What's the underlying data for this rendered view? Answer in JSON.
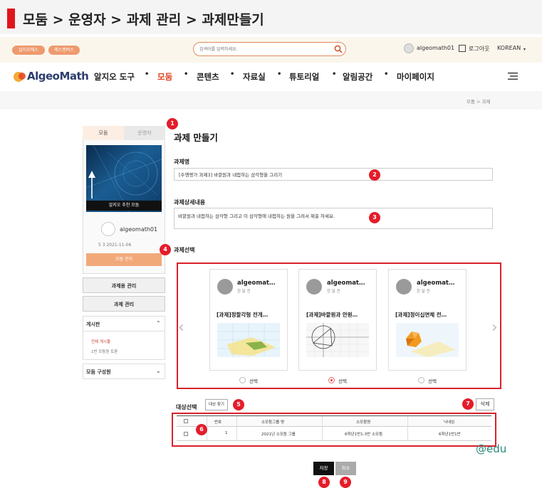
{
  "doc_header": {
    "title": "모둠 > 운영자 > 과제 관리 > 과제만들기"
  },
  "util": {
    "pill_1": "알지오매스",
    "pill_2": "매스캔버스",
    "search_placeholder": "검색어를 입력하세요.",
    "user_name": "algeomath01",
    "logout": "로그아웃",
    "language": "KOREAN",
    "caret": "▾"
  },
  "nav": {
    "logo": "AlgeoMath",
    "items": [
      "알지오 도구",
      "모둠",
      "콘텐츠",
      "자료실",
      "튜토리얼",
      "알림공간",
      "마이페이지"
    ],
    "dot": "•",
    "active_color": "#e2431f"
  },
  "breadcrumb": "모둠 > 과제",
  "sidebar": {
    "tab_group": "모둠",
    "tab_operator": "운영자",
    "banner_caption": "알지오 추천 모둠",
    "username": "algeomath01",
    "stats": "5   3   2021-11-06",
    "action": "모둠 관리",
    "btn_manage_tasks": "과제용 관리",
    "btn_manage_assign": "과제 관리",
    "board_title": "게시판",
    "board_items": [
      "전체 게시물",
      "1번 모둠원 토론"
    ],
    "member_title": "모둠 구성원",
    "caret_up": "⌃",
    "caret_down": "⌄"
  },
  "form": {
    "heading": "과제 만들기",
    "name_label": "과제명",
    "name_value": "[수행평가 과제3] 바깥원과 내접하는 삼각형을 그리기",
    "desc_label": "과제상세내용",
    "desc_value": "바깥원과 내접하는 삼각형 그리고 이 삼각형에 내접하는 원을 그려서 제출 하세요.",
    "select_label": "과제선택",
    "cards": [
      {
        "user": "algeomat…",
        "sub": "한 달 전",
        "title": "[과제]정팔각형 전개…",
        "radio": "선택",
        "selected": false
      },
      {
        "user": "algeomat…",
        "sub": "한 달 전",
        "title": "[과제]바깥원과 안원…",
        "radio": "선택",
        "selected": true
      },
      {
        "user": "algeomat…",
        "sub": "한 달 전",
        "title": "[과제]정이십면체 전…",
        "radio": "선택",
        "selected": false
      }
    ],
    "arrow_left": "‹",
    "arrow_right": "›",
    "target_label": "대상선택",
    "find_target": "대상 찾기",
    "delete": "삭제",
    "table": {
      "headers": [
        "번호",
        "소모둠그룹 명",
        "소모둠명",
        "닉네임"
      ],
      "rows": [
        {
          "no": "1",
          "group": "2021년 소모둠 그룹",
          "team": "6학년1반1-3반 소모둠",
          "nick": "6학년1반1반"
        }
      ]
    },
    "save": "저장",
    "cancel": "취소"
  },
  "markers": [
    "1",
    "2",
    "3",
    "4",
    "5",
    "6",
    "7",
    "8",
    "9"
  ],
  "watermark": "@edu"
}
